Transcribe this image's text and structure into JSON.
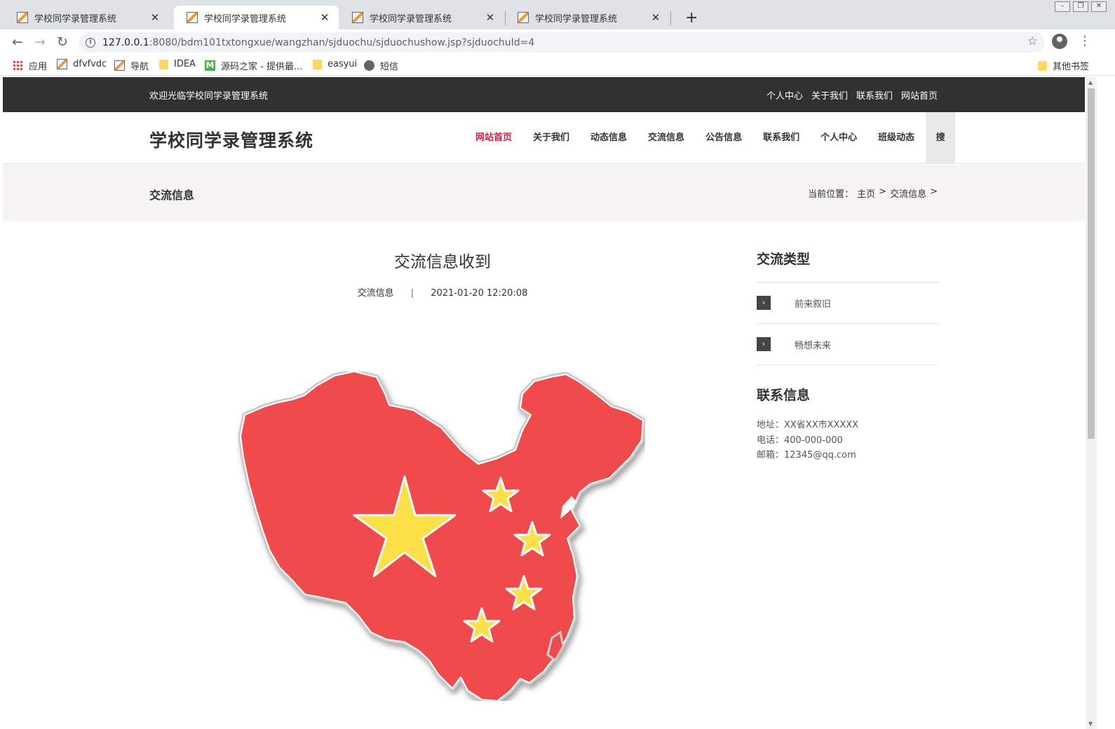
{
  "browser": {
    "tabs": [
      {
        "title": "学校同学录管理系统"
      },
      {
        "title": "学校同学录管理系统"
      },
      {
        "title": "学校同学录管理系统"
      },
      {
        "title": "学校同学录管理系统"
      }
    ],
    "url_host": "127.0.0.1",
    "url_rest": ":8080/bdm101txtongxue/wangzhan/sjduochu/sjduochushow.jsp?sjduochuId=4",
    "bookmarks": [
      {
        "label": "应用",
        "icon": "apps-grid-icon"
      },
      {
        "label": "dfvfvdc",
        "icon": "image-icon"
      },
      {
        "label": "导航",
        "icon": "image-icon"
      },
      {
        "label": "IDEA",
        "icon": "folder-icon"
      },
      {
        "label": "源码之家 - 提供最...",
        "icon": "m-logo-icon"
      },
      {
        "label": "easyui",
        "icon": "folder-icon"
      },
      {
        "label": "短信",
        "icon": "globe-icon"
      }
    ],
    "other_bookmarks": "其他书签"
  },
  "site": {
    "welcome": "欢迎光临学校同学录管理系统",
    "top_links": [
      "个人中心",
      "关于我们",
      "联系我们",
      "网站首页"
    ],
    "logo": "学校同学录管理系统",
    "nav": [
      "网站首页",
      "关于我们",
      "动态信息",
      "交流信息",
      "公告信息",
      "联系我们",
      "个人中心",
      "班级动态"
    ],
    "search_label": "搜",
    "accent_color": "#e4123c",
    "dark_bar_color": "#313131"
  },
  "breadcrumb": {
    "page_title": "交流信息",
    "prefix": "当前位置：",
    "home": "主页",
    "sep1": ">",
    "current": "交流信息",
    "sep2": ">"
  },
  "article": {
    "title": "交流信息收到",
    "category": "交流信息",
    "divider": "|",
    "datetime": "2021-01-20 12:20:08"
  },
  "sidebar": {
    "types_heading": "交流类型",
    "types": [
      "前来叙旧",
      "畅想未来"
    ],
    "contact_heading": "联系信息",
    "address": "地址：XX省XX市XXXXX",
    "phone": "电话：400-000-000",
    "email": "邮箱：12345@qq.com"
  }
}
